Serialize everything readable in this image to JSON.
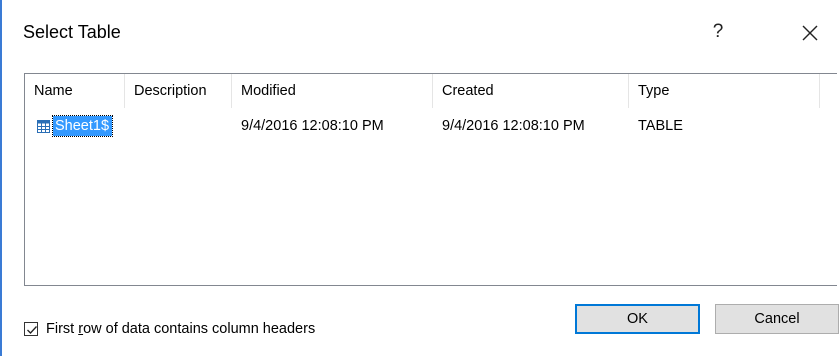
{
  "dialog": {
    "title": "Select Table",
    "help_label": "?"
  },
  "table": {
    "columns": [
      "Name",
      "Description",
      "Modified",
      "Created",
      "Type"
    ],
    "rows": [
      {
        "name": "Sheet1$",
        "description": "",
        "modified": "9/4/2016 12:08:10 PM",
        "created": "9/4/2016 12:08:10 PM",
        "type": "TABLE"
      }
    ]
  },
  "options": {
    "checkbox_prefix": "First ",
    "checkbox_underlined": "r",
    "checkbox_suffix": "ow of data contains column headers",
    "checkbox_checked": true
  },
  "buttons": {
    "ok_label": "OK",
    "cancel_label": "Cancel"
  },
  "colors": {
    "selection": "#3399ff",
    "default_button_border": "#0078d7",
    "button_face": "#e1e1e1",
    "accent_edge": "#3a7bd5"
  },
  "icons": {
    "row_icon": "table-icon",
    "close": "close-icon",
    "check": "checkmark-icon"
  }
}
